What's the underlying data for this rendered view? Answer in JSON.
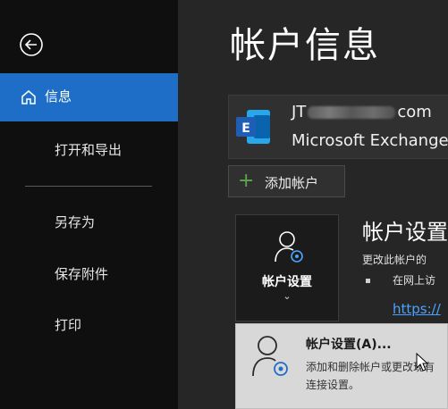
{
  "sidebar": {
    "back_icon": "back-arrow-icon",
    "items": [
      {
        "label": "信息",
        "icon": "home-icon",
        "active": true
      },
      {
        "label": "打开和导出"
      },
      {
        "label": "另存为"
      },
      {
        "label": "保存附件"
      },
      {
        "label": "打印"
      }
    ]
  },
  "main": {
    "title": "帐户信息",
    "account": {
      "email_prefix": "JT",
      "email_suffix": "com",
      "type": "Microsoft Exchange",
      "icon": "exchange-icon"
    },
    "add_account_label": "添加帐户",
    "settings_tile": {
      "label": "帐户设置",
      "chevron": "⌄",
      "icon": "account-settings-icon"
    },
    "section_title": "帐户设置",
    "section_desc": "更改此帐户的",
    "bullet_text": "在网上访",
    "link_text": "https://"
  },
  "menu": {
    "items": [
      {
        "title": "帐户设置(A)...",
        "desc": "添加和删除帐户或更改现有连接设置。",
        "icon": "account-settings-icon"
      }
    ]
  },
  "colors": {
    "sidebar_bg": "#0f0f0f",
    "active_nav": "#1e6ec8",
    "main_bg": "#262626",
    "link": "#4aa3ff",
    "add_plus": "#5aa84a",
    "menu_bg": "#d8d8d8"
  }
}
